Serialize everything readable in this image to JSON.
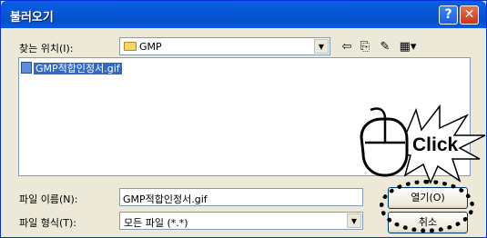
{
  "window": {
    "title": "불러오기",
    "help_label": "?",
    "close_label": "✕"
  },
  "location": {
    "label": "찾는 위치(I):",
    "value": "GMP"
  },
  "toolbar": {
    "back_icon": "⇦",
    "up_icon": "⎘",
    "new_folder_icon": "✎",
    "view_icon": "▦▾"
  },
  "files": [
    {
      "name": "GMP적합인정서.gif",
      "selected": true
    }
  ],
  "filename": {
    "label": "파일 이름(N):",
    "value": "GMP적합인정서.gif"
  },
  "filetype": {
    "label": "파일 형식(T):",
    "value": "모든 파일 (*.*)"
  },
  "buttons": {
    "open_label": "열기(O)",
    "cancel_label": "취소"
  },
  "annotation": {
    "click_text": "Click"
  },
  "colors": {
    "title_bar": "#0554d2",
    "selection": "#316ac5"
  }
}
